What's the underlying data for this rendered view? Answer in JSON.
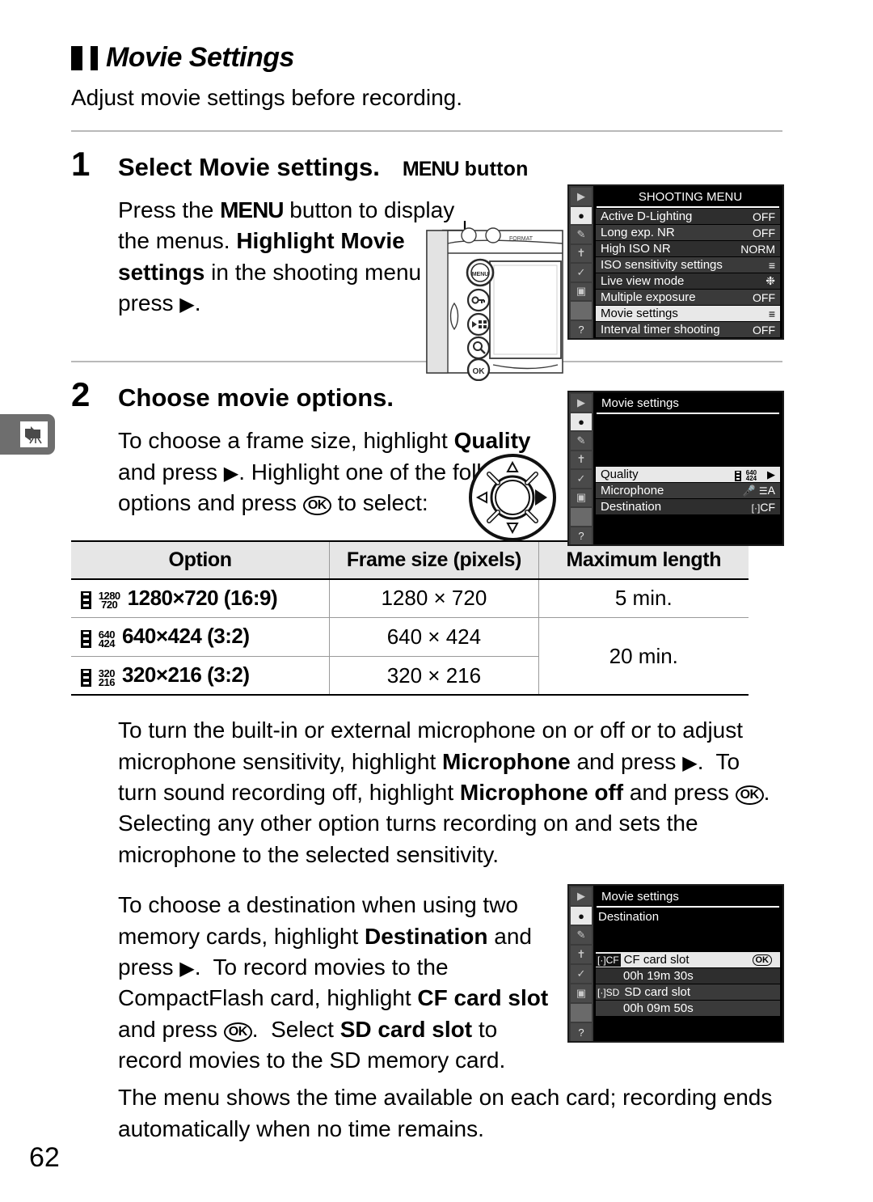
{
  "page": {
    "number": "62",
    "side_tab_icon": "movie-camera-icon"
  },
  "heading": {
    "title": "Movie Settings",
    "lede": "Adjust movie settings before recording."
  },
  "steps": [
    {
      "number": "1",
      "title_prefix": "Select ",
      "title_bold": "Movie settings",
      "title_suffix": ".",
      "callout_label": "MENU button",
      "body_html": "Press the MENU button to display the menus. Highlight Movie settings in the shooting menu and press ▶."
    },
    {
      "number": "2",
      "title": "Choose movie options.",
      "body_html": "To choose a frame size, highlight Quality and press ▶. Highlight one of the following options and press OK to select:"
    }
  ],
  "camera_figure": {
    "buttons": [
      "menu-button",
      "protect-key-button",
      "thumbnail-button",
      "zoom-in-button",
      "ok-button"
    ],
    "format_label": "FORMAT"
  },
  "shooting_menu": {
    "title": "SHOOTING MENU",
    "sidebar_icons": [
      "playback-icon",
      "shooting-menu-icon",
      "custom-settings-pencil-icon",
      "setup-wrench-icon",
      "retouch-icon",
      "recent-settings-icon",
      "help-question-icon"
    ],
    "rows": [
      {
        "label": "Active D-Lighting",
        "value": "OFF",
        "highlighted": false
      },
      {
        "label": "Long exp. NR",
        "value": "OFF",
        "highlighted": false
      },
      {
        "label": "High ISO NR",
        "value": "NORM",
        "highlighted": false
      },
      {
        "label": "ISO sensitivity settings",
        "value": "≡",
        "highlighted": false
      },
      {
        "label": "Live view mode",
        "value": "❉",
        "highlighted": false
      },
      {
        "label": "Multiple exposure",
        "value": "OFF",
        "highlighted": false
      },
      {
        "label": "Movie settings",
        "value": "≡",
        "highlighted": true
      },
      {
        "label": "Interval timer shooting",
        "value": "OFF",
        "highlighted": false
      }
    ]
  },
  "movie_settings_menu": {
    "title": "Movie settings",
    "rows": [
      {
        "label": "Quality",
        "value": "640 424",
        "highlighted": true,
        "has_arrow": true
      },
      {
        "label": "Microphone",
        "value": "A",
        "highlighted": false,
        "has_arrow": false
      },
      {
        "label": "Destination",
        "value": "CF",
        "highlighted": false,
        "has_arrow": false
      }
    ]
  },
  "destination_menu": {
    "title": "Movie settings",
    "subtitle": "Destination",
    "rows": [
      {
        "badge": "CF",
        "label": "CF card slot",
        "time": "00h  19m  30s",
        "ok_badge": "OK",
        "highlighted": true
      },
      {
        "badge": "SD",
        "label": "SD card slot",
        "time": "00h  09m  50s",
        "ok_badge": "",
        "highlighted": false
      }
    ]
  },
  "multi_selector": {
    "name": "multi-selector-dial",
    "highlighted_direction": "right"
  },
  "table": {
    "headers": [
      "Option",
      "Frame size (pixels)",
      "Maximum length"
    ],
    "rows": [
      {
        "glyph_top": "1280",
        "glyph_bottom": "720",
        "option": "1280×720 (16:9)",
        "frame_size": "1280 × 720",
        "max_length": "5 min.",
        "span": 1
      },
      {
        "glyph_top": "640",
        "glyph_bottom": "424",
        "option": "640×424 (3:2)",
        "frame_size": "640 × 424",
        "max_length": "20 min.",
        "span": 2
      },
      {
        "glyph_top": "320",
        "glyph_bottom": "216",
        "option": "320×216 (3:2)",
        "frame_size": "320 × 216",
        "max_length": "",
        "span": 0
      }
    ]
  },
  "paragraphs": {
    "microphone": "To turn the built-in or external microphone on or off or to adjust microphone sensitivity, highlight Microphone and press ▶. To turn sound recording off, highlight Microphone off and press OK. Selecting any other option turns recording on and sets the microphone to the selected sensitivity.",
    "destination": "To choose a destination when using two memory cards, highlight Destination and press ▶. To record movies to the CompactFlash card, highlight CF card slot and press OK. Select SD card slot to record movies to the SD memory card.",
    "closing": "The menu shows the time available on each card; recording ends automatically when no time remains."
  },
  "colors": {
    "rule": "#b9b9b9",
    "table_header_bg": "#e6e6e6",
    "lcd_bg": "#000000",
    "lcd_highlight": "#e8e8e8",
    "side_tab": "#6e6e6e"
  }
}
